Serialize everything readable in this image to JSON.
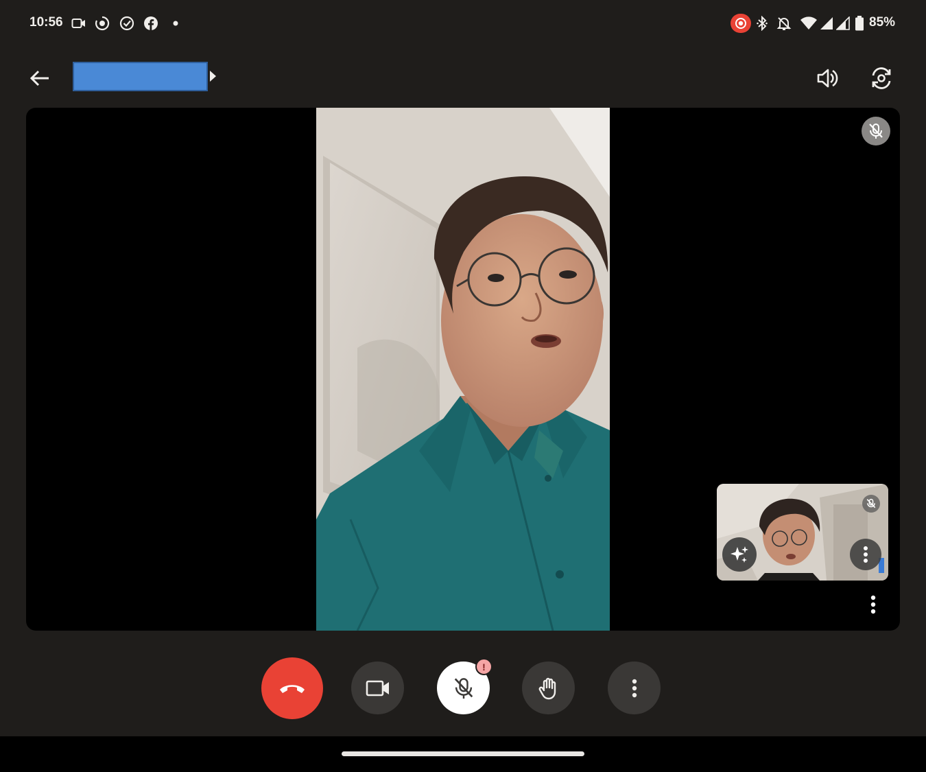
{
  "status_bar": {
    "time": "10:56",
    "battery": "85%",
    "left_icons": [
      "video-camera-icon",
      "screen-record-icon",
      "check-circle-icon",
      "facebook-icon",
      "dot-icon"
    ],
    "right_icons": [
      "recording-indicator-icon",
      "bluetooth-icon",
      "bell-off-icon",
      "wifi-icon",
      "signal-icon",
      "signal-icon",
      "battery-icon"
    ]
  },
  "app_bar": {
    "title": "",
    "title_block_color": "#4a89d6",
    "icons": [
      "back-arrow-icon",
      "volume-icon",
      "switch-camera-icon"
    ]
  },
  "stage": {
    "participant_muted": true,
    "self_view": {
      "muted": true,
      "icons": [
        "sparkle-effects-icon",
        "more-vert-icon",
        "mic-off-icon"
      ]
    }
  },
  "controls": {
    "end_call_color": "#e94235",
    "buttons": [
      "end-call",
      "camera",
      "mic-muted",
      "raise-hand",
      "more-options"
    ],
    "mic_alert": "!"
  },
  "colors": {
    "background": "#1f1d1b",
    "stage": "#000000",
    "control_bg": "#3a3836",
    "shirt": "#1f6f73"
  }
}
